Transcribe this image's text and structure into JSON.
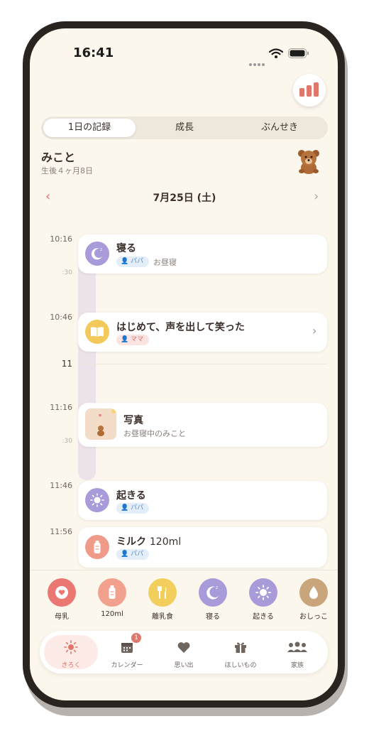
{
  "status": {
    "time": "16:41"
  },
  "segments": [
    "1日の記録",
    "成長",
    "ぶんせき"
  ],
  "profile": {
    "name": "みこと",
    "age": "生後４ヶ月8日"
  },
  "date": "7月25日 (土)",
  "timeline_labels": {
    "t1": "10:16",
    "t1b": ":30",
    "t2": "10:46",
    "h11": "11",
    "t3": "11:16",
    "t3b": ":30",
    "t4": "11:46",
    "t5": "11:56"
  },
  "entries": [
    {
      "title": "寝る",
      "tag": "パパ",
      "note": "お昼寝",
      "color": "#a99ad9"
    },
    {
      "title": "はじめて、声を出して笑った",
      "tag": "ママ",
      "color": "#f2c95a"
    },
    {
      "title": "写真",
      "note": "お昼寝中のみこと"
    },
    {
      "title": "起きる",
      "tag": "パパ",
      "color": "#a99ad9"
    },
    {
      "title": "ミルク",
      "amount": "120ml",
      "tag": "パパ",
      "color": "#f09b8a"
    }
  ],
  "quick_actions": [
    {
      "label": "母乳",
      "color": "#ea7771"
    },
    {
      "label": "120ml",
      "color": "#f3a18f"
    },
    {
      "label": "離乳食",
      "color": "#f2cf5c"
    },
    {
      "label": "寝る",
      "color": "#a99ad9"
    },
    {
      "label": "起きる",
      "color": "#a99ad9"
    },
    {
      "label": "おしっこ",
      "color": "#c9a57c"
    }
  ],
  "tabs": [
    {
      "label": "きろく",
      "icon": "sun-icon"
    },
    {
      "label": "カレンダー",
      "icon": "calendar-icon",
      "badge": "1"
    },
    {
      "label": "思い出",
      "icon": "heart-icon"
    },
    {
      "label": "ほしいもの",
      "icon": "gift-icon"
    },
    {
      "label": "家族",
      "icon": "family-icon"
    }
  ],
  "colors": {
    "accent": "#e0776b",
    "background": "#fcf7ec"
  }
}
